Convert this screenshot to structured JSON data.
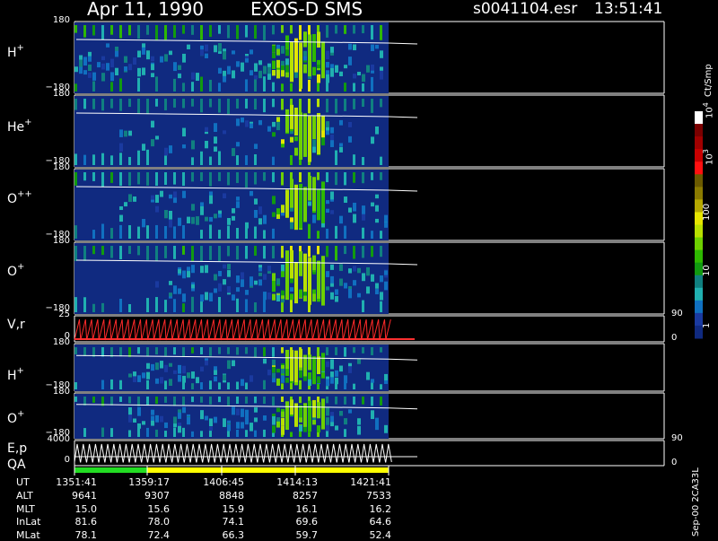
{
  "header": {
    "date": "Apr 11, 1990",
    "mission": "EXOS-D SMS",
    "file": "s0041104.esr",
    "time": "13:51:41"
  },
  "panels": [
    {
      "label_base": "H",
      "label_sup": "+",
      "top_tick": "180",
      "bottom_tick": "−180"
    },
    {
      "label_base": "He",
      "label_sup": "+",
      "top_tick": "180",
      "bottom_tick": "−180"
    },
    {
      "label_base": "O",
      "label_sup": "++",
      "top_tick": "180",
      "bottom_tick": "−180"
    },
    {
      "label_base": "O",
      "label_sup": "+",
      "top_tick": "180",
      "bottom_tick": "−180"
    },
    {
      "label_base": "V,r",
      "label_sup": "",
      "top_tick": "25",
      "bottom_tick": "0"
    },
    {
      "label_base": "H",
      "label_sup": "+",
      "top_tick": "180",
      "bottom_tick": "−180"
    },
    {
      "label_base": "O",
      "label_sup": "+",
      "top_tick": "180",
      "bottom_tick": "−180"
    },
    {
      "label_base": "E,p",
      "label_sup": "",
      "top_tick": "4000",
      "bottom_tick": "0"
    }
  ],
  "qa_label": "QA",
  "right_ticks": {
    "vr_top": "90",
    "vr_bottom": "0",
    "ep_top": "90",
    "ep_bottom": "0"
  },
  "colorbar": {
    "unit": "Ct/Smp",
    "labels": [
      {
        "base": "10",
        "exp": "4"
      },
      {
        "base": "10",
        "exp": "3"
      },
      {
        "base": "100",
        "exp": ""
      },
      {
        "base": "10",
        "exp": ""
      },
      {
        "base": "1",
        "exp": ""
      }
    ],
    "colors": [
      "#ffffff",
      "#7a0000",
      "#a00000",
      "#c80000",
      "#ff1010",
      "#6b5a00",
      "#8a7a00",
      "#b5a800",
      "#e6e600",
      "#b8e000",
      "#6ed000",
      "#2eb800",
      "#119a10",
      "#108080",
      "#20b0b0",
      "#1070c0",
      "#1a3aa0",
      "#102a80"
    ]
  },
  "version_tag": "Sep-00 2CA33L",
  "footer": {
    "row_labels": [
      "UT",
      "ALT",
      "MLT",
      "InLat",
      "MLat"
    ],
    "columns": [
      [
        "1351:41",
        "9641",
        "15.0",
        "81.6",
        "78.1"
      ],
      [
        "1359:17",
        "9307",
        "15.6",
        "78.0",
        "72.4"
      ],
      [
        "1406:45",
        "8848",
        "15.9",
        "74.1",
        "66.3"
      ],
      [
        "1414:13",
        "8257",
        "16.1",
        "69.6",
        "59.7"
      ],
      [
        "1421:41",
        "7533",
        "16.2",
        "64.6",
        "52.4"
      ]
    ]
  },
  "chart_data": {
    "type": "heatmap",
    "title": "Apr 11, 1990 EXOS-D SMS s0041104.esr 13:51:41",
    "x_ticks": [
      "1351:41",
      "1359:17",
      "1406:45",
      "1414:13",
      "1421:41"
    ],
    "data_coverage_end": "1421:41",
    "series": [
      {
        "name": "H+",
        "ylim": [
          -180,
          180
        ],
        "colorscale": "log Ct/Smp 1 to 10^4"
      },
      {
        "name": "He+",
        "ylim": [
          -180,
          180
        ],
        "colorscale": "log Ct/Smp 1 to 10^4"
      },
      {
        "name": "O++",
        "ylim": [
          -180,
          180
        ],
        "colorscale": "log Ct/Smp 1 to 10^4"
      },
      {
        "name": "O+",
        "ylim": [
          -180,
          180
        ],
        "colorscale": "log Ct/Smp 1 to 10^4"
      },
      {
        "name": "V,r",
        "ylim": [
          0,
          25
        ],
        "right_ylim": [
          0,
          90
        ],
        "style": "red sawtooth"
      },
      {
        "name": "H+",
        "ylim": [
          -180,
          180
        ],
        "colorscale": "log Ct/Smp 1 to 10^4"
      },
      {
        "name": "O+",
        "ylim": [
          -180,
          180
        ],
        "colorscale": "log Ct/Smp 1 to 10^4"
      },
      {
        "name": "E,p",
        "ylim": [
          0,
          4000
        ],
        "right_ylim": [
          0,
          90
        ],
        "style": "white sweep"
      }
    ],
    "qa": [
      {
        "from": "1351:41",
        "to": "1359:17",
        "color": "#22dd22"
      },
      {
        "from": "1359:17",
        "to": "1421:41",
        "color": "#ffff00"
      }
    ]
  }
}
